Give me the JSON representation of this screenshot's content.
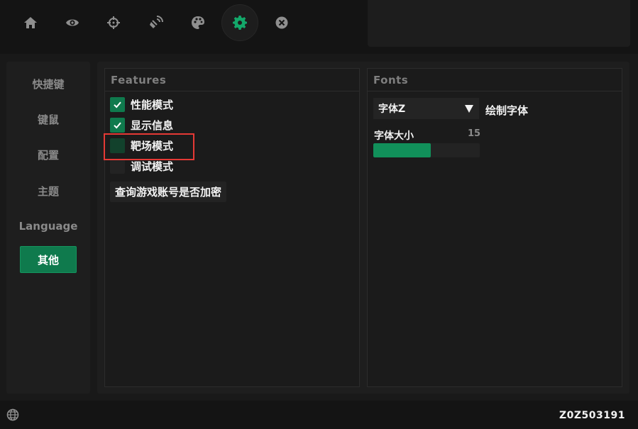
{
  "topbar": {
    "tabs": [
      {
        "icon": "home-icon"
      },
      {
        "icon": "eye-icon"
      },
      {
        "icon": "crosshair-icon"
      },
      {
        "icon": "radar-icon"
      },
      {
        "icon": "palette-icon"
      },
      {
        "icon": "gear-icon",
        "active": true
      },
      {
        "icon": "close-icon"
      }
    ]
  },
  "sidebar": {
    "items": [
      {
        "label": "快捷键"
      },
      {
        "label": "键鼠"
      },
      {
        "label": "配置"
      },
      {
        "label": "主题"
      },
      {
        "label": "Language"
      },
      {
        "label": "其他",
        "active": true
      }
    ]
  },
  "features": {
    "title": "Features",
    "checkboxes": [
      {
        "label": "性能模式",
        "checked": true
      },
      {
        "label": "显示信息",
        "checked": true
      },
      {
        "label": "靶场模式",
        "checked": false
      },
      {
        "label": "调试模式",
        "checked": false
      }
    ],
    "query_button": "查询游戏账号是否加密"
  },
  "fonts": {
    "title": "Fonts",
    "font_select": {
      "value": "字体Z"
    },
    "font_select_label": "绘制字体",
    "size_label": "字体大小",
    "size_value": "15",
    "size_fraction": 0.54
  },
  "status": {
    "version": "Z0Z503191"
  },
  "colors": {
    "accent": "#0f7a4d",
    "highlight_box": "#e53935"
  }
}
